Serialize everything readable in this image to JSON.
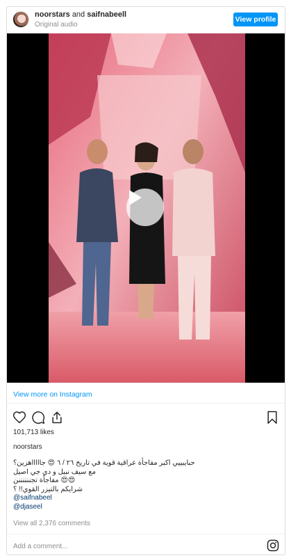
{
  "header": {
    "user1": "noorstars",
    "and_text": "and",
    "user2": "saifnabeell",
    "audio": "Original audio",
    "view_profile": "View profile"
  },
  "post": {
    "view_more": "View more on Instagram",
    "likes": "101,713 likes",
    "owner": "noorstars",
    "caption_lines": [
      "حبايبييي اكبر مفاجأة عراقية قوية في تاريخ ٢٦ / ٦ 😍 جاااااهزين؟",
      "مع سيف نبيل و دي جي اصيل",
      "😍😍 مفاجأة تجننننننن",
      "شرايكم بالتيزر القوي!! ؟"
    ],
    "mentions": [
      "@saifnabeel",
      "@djaseel"
    ],
    "comments_link": "View all 2,376 comments",
    "add_comment_placeholder": "Add a comment..."
  },
  "icons": {
    "like": "heart-icon",
    "comment": "comment-icon",
    "share": "share-icon",
    "save": "bookmark-icon",
    "play": "play-icon",
    "brand": "instagram-icon"
  },
  "colors": {
    "accent": "#0095f6",
    "muted": "#8e8e8e",
    "text": "#262626",
    "mention": "#00376b"
  }
}
